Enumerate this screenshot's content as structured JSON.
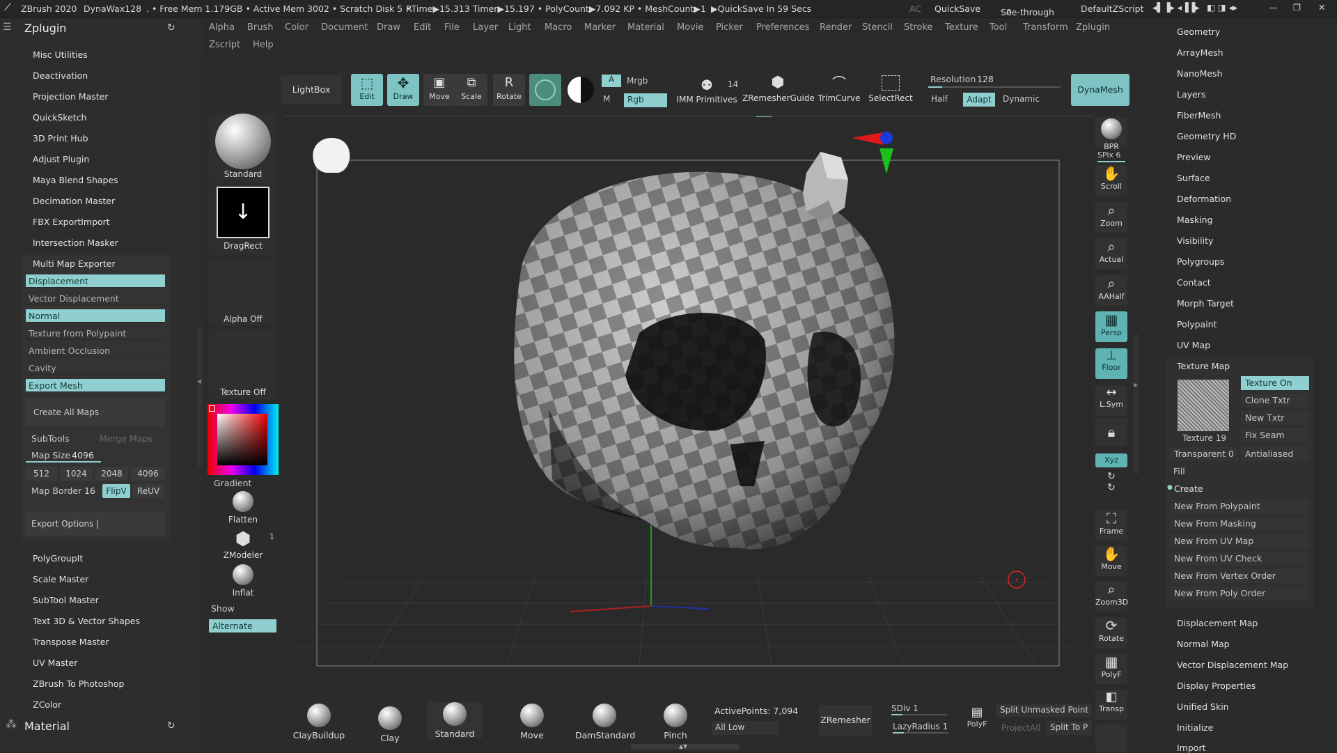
{
  "titlebar": {
    "app": "ZBrush 2020",
    "file": "DynaWax128",
    "stats": ". • Free Mem 1.179GB • Active Mem 3002 • Scratch Disk 5 •",
    "rtime": "RTime▶15.313 Timer▶15.197 • PolyCount▶7.092 KP • MeshCount▶1",
    "quicksave_status": "▶QuickSave In 59 Secs",
    "ac": "AC",
    "quicksave": "QuickSave",
    "see_through": "See-through",
    "see_through_value": "0",
    "script": "DefaultZScript"
  },
  "menu": [
    "Alpha",
    "Brush",
    "Color",
    "Document",
    "Draw",
    "Edit",
    "File",
    "Layer",
    "Light",
    "Macro",
    "Marker",
    "Material",
    "Movie",
    "Picker",
    "Preferences",
    "Render",
    "Stencil",
    "Stroke",
    "Texture",
    "Tool",
    "Transform",
    "Zplugin",
    "Zscript",
    "Help"
  ],
  "left": {
    "header": "Zplugin",
    "items_top": [
      "Misc Utilities",
      "Deactivation",
      "Projection Master",
      "QuickSketch",
      "3D Print Hub",
      "Adjust Plugin",
      "Maya Blend Shapes",
      "Decimation Master",
      "FBX ExportImport",
      "Intersection Masker",
      "Multi Map Exporter"
    ],
    "mme_rows": [
      "Displacement",
      "Vector Displacement",
      "Normal",
      "Texture from Polypaint",
      "Ambient Occlusion",
      "Cavity",
      "Export Mesh"
    ],
    "create_all": "Create All Maps",
    "subtools": "SubTools",
    "merge_maps": "Merge Maps",
    "map_size_label": "Map Size",
    "map_size_value": "4096",
    "sizes": [
      "512",
      "1024",
      "2048",
      "4096"
    ],
    "map_border_label": "Map Border",
    "map_border_value": "16",
    "flipv": "FlipV",
    "reuv": "ReUV",
    "export_options": "Export Options |",
    "items_bottom": [
      "PolyGroupIt",
      "Scale Master",
      "SubTool Master",
      "Text 3D & Vector Shapes",
      "Transpose Master",
      "UV Master",
      "ZBrush To Photoshop",
      "ZColor"
    ],
    "footer": "Material"
  },
  "shelf": {
    "lightbox": "LightBox",
    "edit": "Edit",
    "draw": "Draw",
    "move": "Move",
    "scale": "Scale",
    "rotate": "Rotate",
    "a": "A",
    "mrgb": "Mrgb",
    "m": "M",
    "rgb": "Rgb",
    "imm": "IMM Primitives",
    "imm_count": "14",
    "zremesher_guide": "ZRemesherGuide",
    "trimcurve": "TrimCurve",
    "selectrect": "SelectRect",
    "resolution_label": "Resolution",
    "resolution_value": "128",
    "half": "Half",
    "adapt": "Adapt",
    "dynamic": "Dynamic",
    "dynamesh": "DynaMesh"
  },
  "brushcol": {
    "standard": "Standard",
    "dragrect": "DragRect",
    "alpha_off": "Alpha Off",
    "texture_off": "Texture Off",
    "gradient": "Gradient",
    "flatten": "Flatten",
    "zmodeler": "ZModeler",
    "zmodeler_count": "1",
    "inflat": "Inflat",
    "show": "Show",
    "alternate": "Alternate"
  },
  "righttool": [
    "BPR",
    "SPix 6",
    "Scroll",
    "Zoom",
    "Actual",
    "AAHalf",
    "Persp",
    "Floor",
    "L.Sym",
    "",
    "Xyz",
    "",
    "Frame",
    "Move",
    "Zoom3D",
    "Rotate",
    "PolyF",
    "Transp"
  ],
  "rightpanel": {
    "items_top": [
      "Geometry",
      "ArrayMesh",
      "NanoMesh",
      "Layers",
      "FiberMesh",
      "Geometry HD",
      "Preview",
      "Surface",
      "Deformation",
      "Masking",
      "Visibility",
      "Polygroups",
      "Contact",
      "Morph Target",
      "Polypaint",
      "UV Map"
    ],
    "texture_map": "Texture Map",
    "texture_on": "Texture On",
    "clone_txtr": "Clone Txtr",
    "new_txtr": "New Txtr",
    "fix_seam": "Fix Seam",
    "texture_name": "Texture 19",
    "transparent": "Transparent 0",
    "antialiased": "Antialiased",
    "fill": "Fill",
    "create": "Create",
    "create_items": [
      "New From Polypaint",
      "New From Masking",
      "New From UV Map",
      "New From UV Check",
      "New From Vertex Order",
      "New From Poly Order"
    ],
    "items_bottom": [
      "Displacement Map",
      "Normal Map",
      "Vector Displacement Map",
      "Display Properties",
      "Unified Skin",
      "Initialize",
      "Import"
    ]
  },
  "bottom": {
    "brushes": [
      "ClayBuildup",
      "Clay",
      "Standard",
      "Move",
      "DamStandard",
      "Pinch"
    ],
    "active_points": "ActivePoints: 7,094",
    "all_low": "All Low",
    "zremesher": "ZRemesher",
    "sdiv": "SDiv 1",
    "lazyradius": "LazyRadius 1",
    "polyf": "PolyF",
    "split_unmasked": "Split Unmasked Point",
    "projectall": "ProjectAll",
    "split_to": "Split To P"
  },
  "colors": {
    "accent": "#8fcfcf",
    "accent_dark": "#5fb3b3"
  }
}
